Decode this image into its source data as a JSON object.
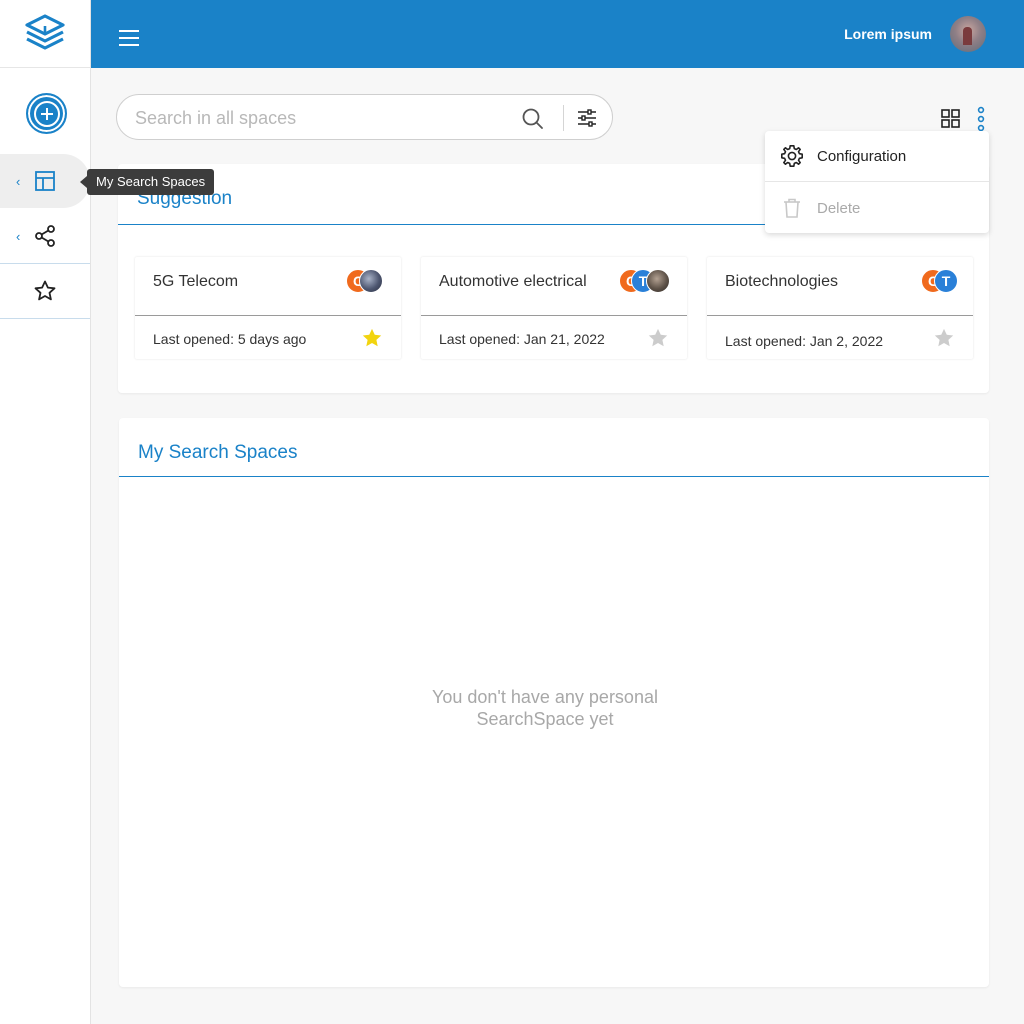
{
  "header": {
    "username": "Lorem ipsum"
  },
  "sidebar": {
    "tooltip": "My Search Spaces"
  },
  "search": {
    "placeholder": "Search in all spaces"
  },
  "menu": {
    "configuration_label": "Configuration",
    "delete_label": "Delete"
  },
  "suggestion": {
    "title": "Suggestion",
    "cards": [
      {
        "title": "5G Telecom",
        "last_opened": "Last opened: 5 days ago",
        "starred": true,
        "avatar_1": "C"
      },
      {
        "title": "Automotive electrical",
        "last_opened": "Last opened: Jan 21, 2022",
        "starred": false,
        "avatar_1": "C",
        "avatar_2": "T"
      },
      {
        "title": "Biotechnologies",
        "last_opened": "Last opened: Jan 2, 2022",
        "starred": false,
        "avatar_1": "C",
        "avatar_2": "T"
      }
    ]
  },
  "my_spaces": {
    "title": "My Search Spaces",
    "empty_line_1": "You don't have any personal",
    "empty_line_2": "SearchSpace yet"
  },
  "colors": {
    "brand": "#1a82c8",
    "star_active": "#f2d40f",
    "star_inactive": "#cccccc"
  }
}
